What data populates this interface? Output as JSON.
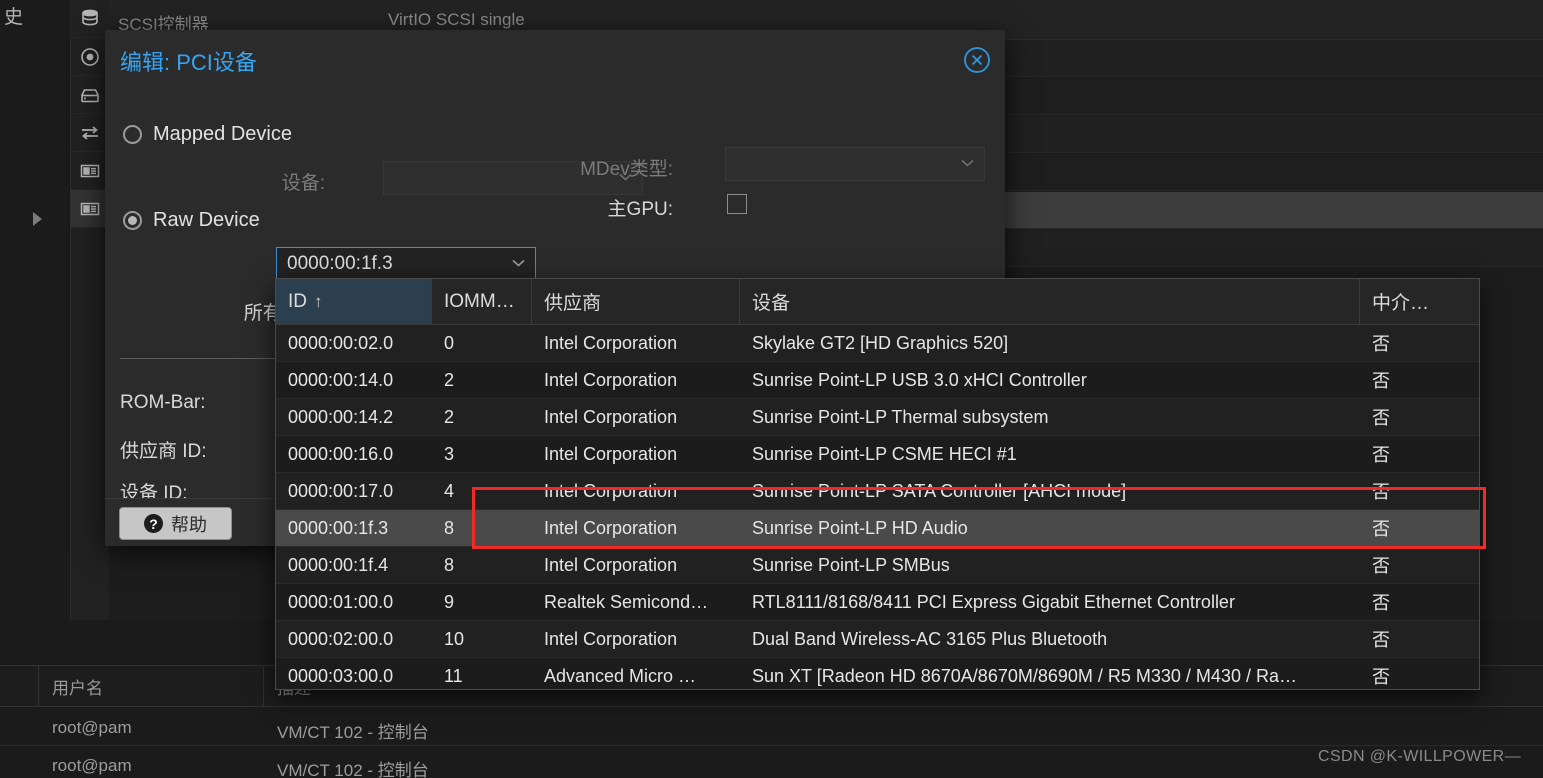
{
  "background": {
    "corner_text": "史",
    "toolbar_row": {
      "label": "SCSI控制器",
      "value": "VirtIO SCSI single"
    },
    "rail_icons": [
      "database-icon",
      "optical-disc-icon",
      "hard-drive-icon",
      "network-transfer-icon",
      "pci-card-icon",
      "pci-card-icon"
    ]
  },
  "dialog": {
    "title": "编辑: PCI设备",
    "close_icon": "close-circle-icon",
    "mapped_device": {
      "label": "Mapped Device",
      "selected": false
    },
    "raw_device": {
      "label": "Raw Device",
      "selected": true
    },
    "mapped_device_field": {
      "label": "设备:",
      "value": "",
      "disabled": true
    },
    "raw_device_field": {
      "label": "设备:",
      "value": "0000:00:1f.3",
      "focused": true
    },
    "mdev_type": {
      "label": "MDev类型:",
      "value": "",
      "disabled": true
    },
    "primary_gpu": {
      "label": "主GPU:",
      "checked": false
    },
    "all_functions": {
      "label": "所有功能:"
    },
    "rom_bar": {
      "label": "ROM-Bar:"
    },
    "vendor_id": {
      "label": "供应商 ID:"
    },
    "device_id": {
      "label": "设备 ID:"
    },
    "help_button": {
      "label": "帮助",
      "icon": "question-mark-icon"
    }
  },
  "dropdown": {
    "columns": [
      {
        "key": "id",
        "label": "ID",
        "sorted": true,
        "sort_dir": "↑"
      },
      {
        "key": "iommu",
        "label": "IOMM…",
        "sorted": false
      },
      {
        "key": "vendor",
        "label": "供应商",
        "sorted": false
      },
      {
        "key": "device",
        "label": "设备",
        "sorted": false
      },
      {
        "key": "mediated",
        "label": "中介…",
        "sorted": false
      }
    ],
    "rows": [
      {
        "id": "0000:00:02.0",
        "iommu": "0",
        "vendor": "Intel Corporation",
        "device": "Skylake GT2 [HD Graphics 520]",
        "mediated": "否",
        "selected": false
      },
      {
        "id": "0000:00:14.0",
        "iommu": "2",
        "vendor": "Intel Corporation",
        "device": "Sunrise Point-LP USB 3.0 xHCI Controller",
        "mediated": "否",
        "selected": false
      },
      {
        "id": "0000:00:14.2",
        "iommu": "2",
        "vendor": "Intel Corporation",
        "device": "Sunrise Point-LP Thermal subsystem",
        "mediated": "否",
        "selected": false
      },
      {
        "id": "0000:00:16.0",
        "iommu": "3",
        "vendor": "Intel Corporation",
        "device": "Sunrise Point-LP CSME HECI #1",
        "mediated": "否",
        "selected": false
      },
      {
        "id": "0000:00:17.0",
        "iommu": "4",
        "vendor": "Intel Corporation",
        "device": "Sunrise Point-LP SATA Controller [AHCI mode]",
        "mediated": "否",
        "selected": false
      },
      {
        "id": "0000:00:1f.3",
        "iommu": "8",
        "vendor": "Intel Corporation",
        "device": "Sunrise Point-LP HD Audio",
        "mediated": "否",
        "selected": true
      },
      {
        "id": "0000:00:1f.4",
        "iommu": "8",
        "vendor": "Intel Corporation",
        "device": "Sunrise Point-LP SMBus",
        "mediated": "否",
        "selected": false
      },
      {
        "id": "0000:01:00.0",
        "iommu": "9",
        "vendor": "Realtek Semicond…",
        "device": "RTL8111/8168/8411 PCI Express Gigabit Ethernet Controller",
        "mediated": "否",
        "selected": false
      },
      {
        "id": "0000:02:00.0",
        "iommu": "10",
        "vendor": "Intel Corporation",
        "device": "Dual Band Wireless-AC 3165 Plus Bluetooth",
        "mediated": "否",
        "selected": false
      },
      {
        "id": "0000:03:00.0",
        "iommu": "11",
        "vendor": "Advanced Micro …",
        "device": "Sun XT [Radeon HD 8670A/8670M/8690M / R5 M330 / M430 / Ra…",
        "mediated": "否",
        "selected": false
      }
    ]
  },
  "log": {
    "headers": [
      "用户名",
      "描述"
    ],
    "rows": [
      {
        "user": "root@pam",
        "desc": "VM/CT 102 - 控制台"
      },
      {
        "user": "root@pam",
        "desc": "VM/CT 102 - 控制台"
      }
    ]
  },
  "annotation": {
    "highlight_color": "#ee2b26"
  },
  "watermark": {
    "text": "CSDN @K-WILLPOWER—"
  }
}
